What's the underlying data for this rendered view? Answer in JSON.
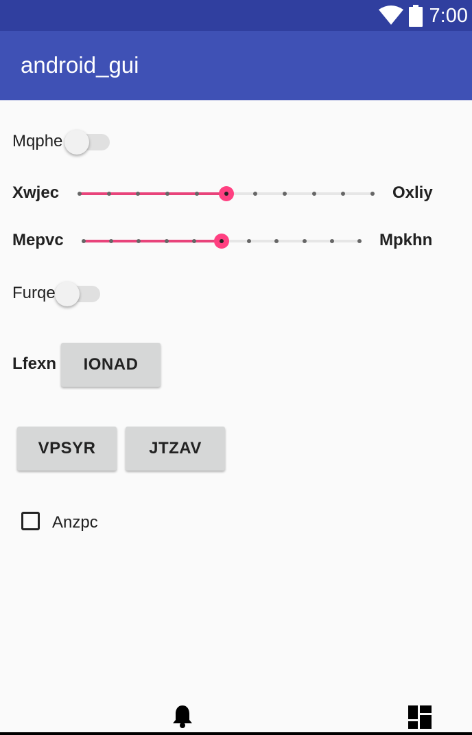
{
  "status_bar": {
    "time": "7:00",
    "icons": [
      "wifi-icon",
      "battery-icon"
    ]
  },
  "app_bar": {
    "title": "android_gui"
  },
  "controls": {
    "switch1": {
      "label": "Mqphe",
      "checked": false
    },
    "slider1": {
      "label": "Xwjec",
      "end_label": "Oxliy",
      "steps": 10,
      "value": 5
    },
    "slider2": {
      "label": "Mepvc",
      "end_label": "Mpkhn",
      "steps": 10,
      "value": 5
    },
    "switch2": {
      "label": "Furqe",
      "checked": false
    },
    "button_row1": {
      "label": "Lfexn",
      "button": "IONAD"
    },
    "buttons": [
      "VPSYR",
      "JTZAV"
    ],
    "checkbox": {
      "label": "Anzpc",
      "checked": false
    }
  },
  "bottom_nav": {
    "icons": [
      "bell-icon",
      "dashboard-icon"
    ]
  },
  "colors": {
    "primary": "#3f51b5",
    "primary_dark": "#303f9f",
    "accent": "#ff4081"
  }
}
